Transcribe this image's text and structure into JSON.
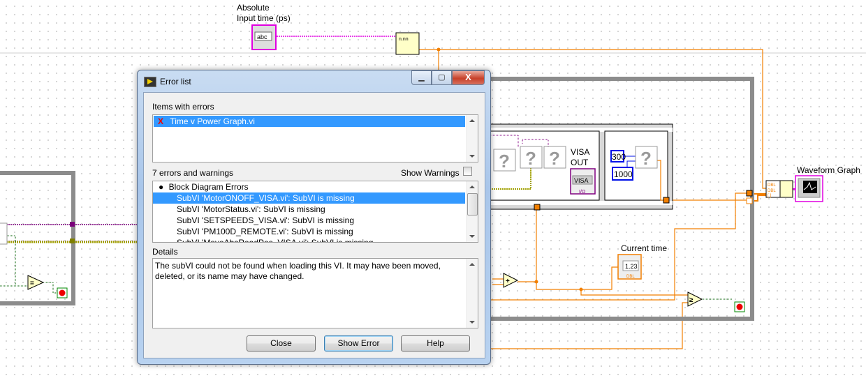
{
  "diagram": {
    "absolute_label_line1": "Absolute",
    "absolute_label_line2": "Input time (ps)",
    "string_control_text": "abc",
    "visa_label_line1": "VISA",
    "visa_label_line2": "OUT",
    "visa_control_text": "VISA",
    "visa_io_text": "I/O",
    "const_300": "300",
    "const_1000": "1000",
    "missing_subvi_glyph": "?",
    "current_time_label": "Current time",
    "current_time_value": "1.23",
    "current_time_type": "DBL",
    "waveform_graph_label": "Waveform Graph",
    "build_array_types": [
      "DBL",
      "DBL",
      "[ ]"
    ],
    "add_symbol": "+",
    "equals_symbol": "=",
    "gte_symbol": "≥",
    "colors": {
      "orange_wire": "#f27f00",
      "pink_wire": "#e000e0",
      "loop_gray": "#8c8c8c",
      "int_blue": "#0010e8"
    }
  },
  "dialog": {
    "title": "Error list",
    "window_buttons": {
      "minimize": "▁",
      "maximize": "▢",
      "close": "X"
    },
    "items_label": "Items with errors",
    "items": [
      {
        "icon": "red-x-icon",
        "mark": "X",
        "label": "Time v Power Graph.vi",
        "selected": true
      }
    ],
    "count_label": "7 errors and warnings",
    "show_warnings_label": "Show Warnings",
    "show_warnings_checked": false,
    "errors_group": "Block Diagram Errors",
    "errors": [
      "SubVI 'MotorONOFF_VISA.vi': SubVI is missing",
      "SubVI 'MotorStatus.vi': SubVI is missing",
      "SubVI 'SETSPEEDS_VISA.vi': SubVI is missing",
      "SubVI 'PM100D_REMOTE.vi': SubVI is missing",
      "SubVI 'MoveAbsReadPos_VISA.vi': SubVI is missing"
    ],
    "selected_error_index": 0,
    "details_label": "Details",
    "details_text": "The subVI could not be found when loading this VI. It may have been moved, deleted, or its name may have changed.",
    "buttons": {
      "close": "Close",
      "show_error": "Show Error",
      "help": "Help"
    }
  }
}
